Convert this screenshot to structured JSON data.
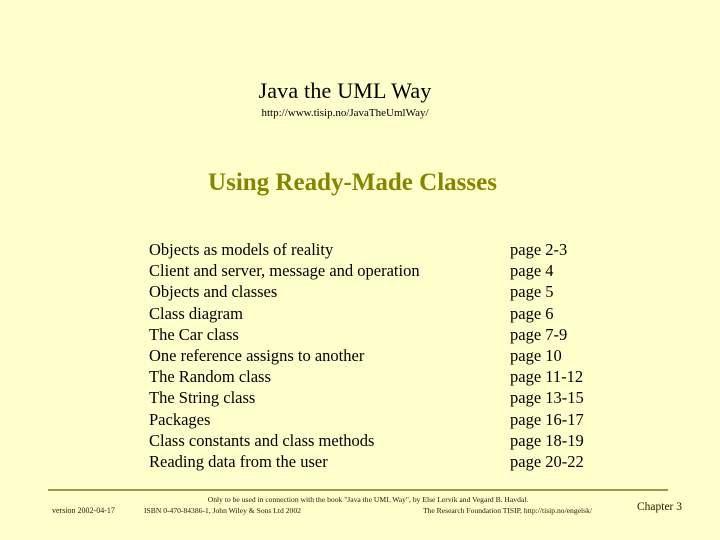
{
  "slide": {
    "background_color": "#ffffcc",
    "header": {
      "book_title": "Java the UML Way",
      "book_url": "http://www.tisip.no/JavaTheUmlWay/"
    },
    "heading": {
      "text": "Using Ready-Made Classes",
      "color": "#858502"
    },
    "contents": {
      "rows": [
        {
          "topic": "Objects as models of reality",
          "page": "page 2-3"
        },
        {
          "topic": "Client and server, message and operation",
          "page": "page 4"
        },
        {
          "topic": "Objects and classes",
          "page": "page 5"
        },
        {
          "topic": "Class diagram",
          "page": "page 6"
        },
        {
          "topic": "The Car class",
          "page": "page 7-9"
        },
        {
          "topic": "One reference assigns to another",
          "page": "page 10"
        },
        {
          "topic": "The Random class",
          "page": "page 11-12"
        },
        {
          "topic": "The String class",
          "page": "page 13-15"
        },
        {
          "topic": "Packages",
          "page": "page 16-17"
        },
        {
          "topic": "Class constants and class methods",
          "page": "page 18-19"
        },
        {
          "topic": "Reading data from the user",
          "page": "page 20-22"
        }
      ]
    },
    "divider": {
      "color": "#9a9a4e"
    },
    "footer": {
      "version": "version 2002-04-17",
      "usage_note": "Only to be used in connection with the book \"Java the UML Way\", by Else Lervik and Vegard B. Havdal.",
      "isbn": "ISBN 0-470-84386-1, John Wiley & Sons Ltd 2002",
      "tisip": "The Research Foundation TISIP, http://tisip.no/engelsk/",
      "chapter": "Chapter 3"
    }
  }
}
